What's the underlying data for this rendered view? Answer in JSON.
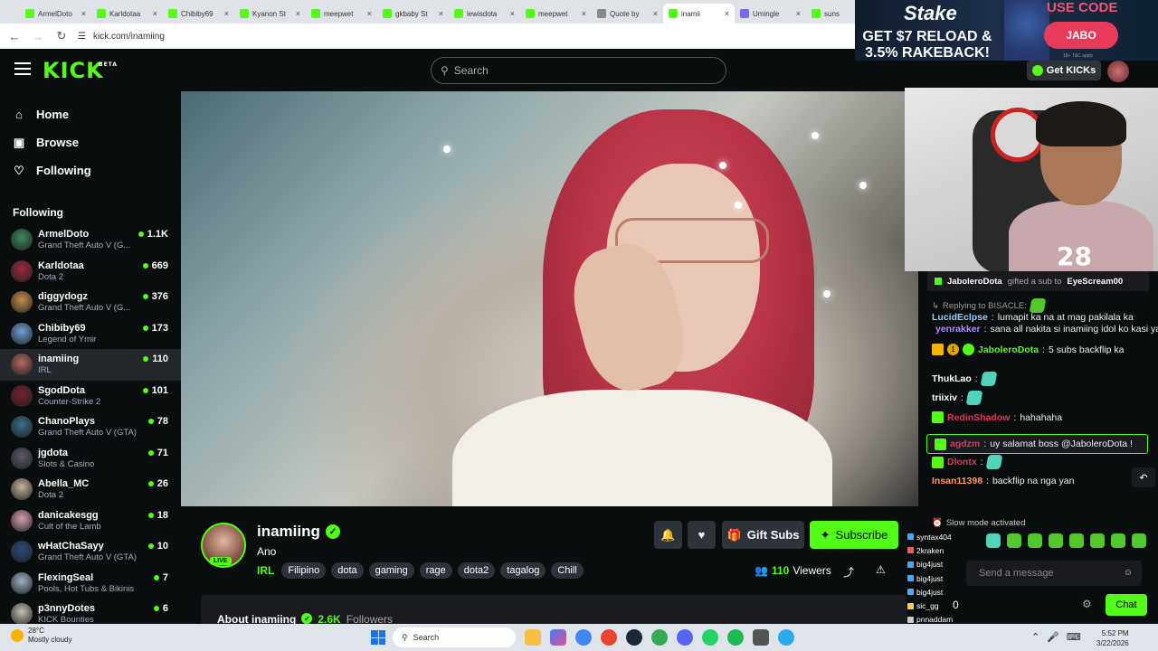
{
  "browser": {
    "tabs": [
      {
        "label": "ArmelDoto",
        "fav": "kick"
      },
      {
        "label": "Karldotaa",
        "fav": "kick"
      },
      {
        "label": "Chibiby69",
        "fav": "kick"
      },
      {
        "label": "Kyanon St",
        "fav": "kick"
      },
      {
        "label": "meepwet",
        "fav": "kick"
      },
      {
        "label": "gkbaby St",
        "fav": "kick"
      },
      {
        "label": "lewisdota",
        "fav": "kick"
      },
      {
        "label": "meepwet",
        "fav": "kick"
      },
      {
        "label": "Quote by",
        "fav": "quote"
      },
      {
        "label": "inamii",
        "fav": "kick"
      },
      {
        "label": "Umingle",
        "fav": "umingle"
      },
      {
        "label": "suns",
        "fav": "kick"
      }
    ],
    "url": "kick.com/inamiing"
  },
  "header": {
    "logo": "KICK",
    "beta": "BETA",
    "search_placeholder": "Search",
    "get_kicks": "Get KICKs"
  },
  "ad": {
    "brand": "Stake",
    "line1": "GET $7 RELOAD &",
    "line2": "3.5% RAKEBACK!",
    "use_code": "USE CODE",
    "code": "JABO",
    "fine": "18+ T&C apply"
  },
  "sidebar": {
    "nav": [
      {
        "label": "Home",
        "icon": "home-icon"
      },
      {
        "label": "Browse",
        "icon": "browse-icon"
      },
      {
        "label": "Following",
        "icon": "heart-icon"
      }
    ],
    "following_title": "Following",
    "following": [
      {
        "name": "ArmelDoto",
        "category": "Grand Theft Auto V (G...",
        "viewers": "1.1K",
        "color": "#3f8a5a"
      },
      {
        "name": "Karldotaa",
        "category": "Dota 2",
        "viewers": "669",
        "color": "#a0283a"
      },
      {
        "name": "diggydogz",
        "category": "Grand Theft Auto V (G...",
        "viewers": "376",
        "color": "#c98f4a"
      },
      {
        "name": "Chibiby69",
        "category": "Legend of Ymir",
        "viewers": "173",
        "color": "#6fa3d8"
      },
      {
        "name": "inamiing",
        "category": "IRL",
        "viewers": "110",
        "color": "#b06a5e"
      },
      {
        "name": "SgodDota",
        "category": "Counter-Strike 2",
        "viewers": "101",
        "color": "#7a2030"
      },
      {
        "name": "ChanoPlays",
        "category": "Grand Theft Auto V (GTA)",
        "viewers": "78",
        "color": "#3a6e8a"
      },
      {
        "name": "jgdota",
        "category": "Slots & Casino",
        "viewers": "71",
        "color": "#5a5a6a"
      },
      {
        "name": "Abella_MC",
        "category": "Dota 2",
        "viewers": "26",
        "color": "#c9b39a"
      },
      {
        "name": "danicakesgg",
        "category": "Cult of the Lamb",
        "viewers": "18",
        "color": "#d8a0b0"
      },
      {
        "name": "wHatChaSayy",
        "category": "Grand Theft Auto V (GTA)",
        "viewers": "10",
        "color": "#2a4a7a"
      },
      {
        "name": "FlexingSeal",
        "category": "Pools, Hot Tubs & Bikinis",
        "viewers": "7",
        "color": "#9ab0c8"
      },
      {
        "name": "p3nnyDotes",
        "category": "KICK Bounties",
        "viewers": "6",
        "color": "#c8c0b8"
      }
    ]
  },
  "channel": {
    "name": "inamiing",
    "live": "LIVE",
    "title": "Ano",
    "category": "IRL",
    "tags": [
      "Filipino",
      "dota",
      "gaming",
      "rage",
      "dota2",
      "tagalog",
      "Chill"
    ],
    "gift_subs": "Gift Subs",
    "subscribe": "Subscribe",
    "viewers_count": "110",
    "viewers_label": "Viewers",
    "about_label": "About inamiing",
    "followers_count": "2.6K",
    "followers_label": "Followers"
  },
  "chat": {
    "pinned": {
      "user": "JaboleroDota",
      "text": "gifted a sub to",
      "target": "EyeScream00"
    },
    "messages": [
      {
        "kind": "reply",
        "reply_text": "Replying to BISACLE:",
        "user": "LucidEclpse",
        "color": "#8fd3ff",
        "text": "lumapit ka na at mag pakilala ka"
      },
      {
        "kind": "msg",
        "user": "yenrakker",
        "color": "#b38cff",
        "text": "sana all nakita si inamiing idol ko kasi yan e"
      },
      {
        "kind": "msg",
        "user": "JaboleroDota",
        "color": "#53fc18",
        "badge_count": "1",
        "text": "5 subs backflip ka"
      },
      {
        "kind": "emote",
        "user": "ThukLao",
        "color": "#fff"
      },
      {
        "kind": "emote",
        "user": "triixiv",
        "color": "#fff"
      },
      {
        "kind": "msg",
        "user": "RedinShadow",
        "color": "#e0395a",
        "text": "hahahaha"
      },
      {
        "kind": "msg",
        "user": "agdzm",
        "color": "#e0395a",
        "text": "uy salamat boss @JaboleroDota !"
      },
      {
        "kind": "emote",
        "user": "Dlontx",
        "color": "#e0395a"
      },
      {
        "kind": "msg",
        "user": "Insan11398",
        "color": "#ff9966",
        "text": "backflip na nga yan"
      }
    ],
    "slow_mode": "Slow mode activated",
    "input_placeholder": "Send a message",
    "zero": "0",
    "send": "Chat",
    "gifters": [
      {
        "name": "syntax404",
        "color": "#4af"
      },
      {
        "name": "2kraken",
        "color": "#f55"
      },
      {
        "name": "big4just",
        "color": "#4af"
      },
      {
        "name": "big4just",
        "color": "#4af"
      },
      {
        "name": "big4just",
        "color": "#4af"
      },
      {
        "name": "sic_gg",
        "color": "#fc4"
      },
      {
        "name": "pnnaddam",
        "color": "#ccc"
      }
    ]
  },
  "taskbar": {
    "temp": "28°C",
    "weather": "Mostly cloudy",
    "search": "Search",
    "time": "5:52 PM",
    "date": "3/22/2026"
  }
}
